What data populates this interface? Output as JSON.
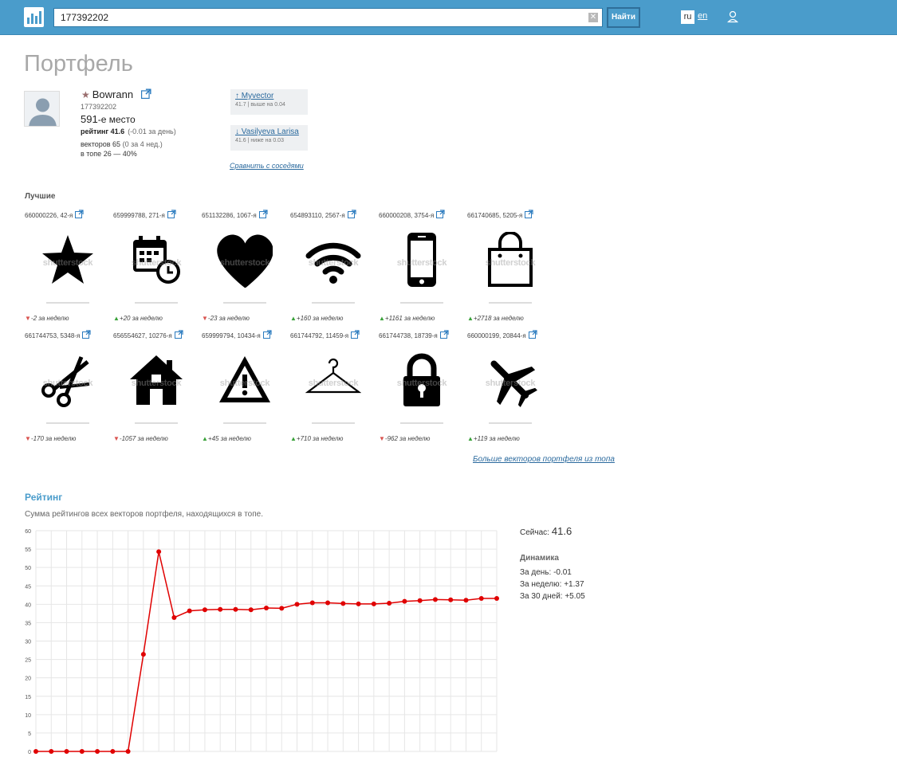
{
  "header": {
    "search_value": "177392202",
    "find_label": "Найти",
    "lang_ru": "ru",
    "lang_en": "en"
  },
  "page_title": "Портфель",
  "profile": {
    "name": "Bowrann",
    "id": "177392202",
    "place_number": "591",
    "place_suffix": "-е место",
    "rating_label": "рейтинг 41.6",
    "rating_delta": "(-0.01 за день)",
    "vectors_label": "векторов 65",
    "vectors_sub": "(0 за 4 нед.)",
    "top_label": "в топе 26 — 40%"
  },
  "neighbors": [
    {
      "name": "↑ Myvector",
      "sub": "41.7 | выше на 0.04"
    },
    {
      "name": "↓ Vasilyeva Larisa",
      "sub": "41.6 | ниже на 0.03"
    }
  ],
  "compare_link": "Сравнить с соседями",
  "best_label": "Лучшие",
  "watermark": "shutterstock",
  "tiles": [
    {
      "caption": "660000226, 42-я",
      "change": "-2 за неделю",
      "dir": "down",
      "icon": "star-icon"
    },
    {
      "caption": "659999788, 271-я",
      "change": "+20 за неделю",
      "dir": "up",
      "icon": "calendar-clock-icon"
    },
    {
      "caption": "651132286, 1067-я",
      "change": "-23 за неделю",
      "dir": "down",
      "icon": "heart-icon"
    },
    {
      "caption": "654893110, 2567-я",
      "change": "+160 за неделю",
      "dir": "up",
      "icon": "wifi-icon"
    },
    {
      "caption": "660000208, 3754-я",
      "change": "+1161 за неделю",
      "dir": "up",
      "icon": "smartphone-icon"
    },
    {
      "caption": "661740685, 5205-я",
      "change": "+2718 за неделю",
      "dir": "up",
      "icon": "shopping-bag-icon"
    },
    {
      "caption": "661744753, 5348-я",
      "change": "-170 за неделю",
      "dir": "down",
      "icon": "scissors-icon"
    },
    {
      "caption": "656554627, 10276-я",
      "change": "-1057 за неделю",
      "dir": "down",
      "icon": "house-icon"
    },
    {
      "caption": "659999794, 10434-я",
      "change": "+45 за неделю",
      "dir": "up",
      "icon": "warning-icon"
    },
    {
      "caption": "661744792, 11459-я",
      "change": "+710 за неделю",
      "dir": "up",
      "icon": "hanger-icon"
    },
    {
      "caption": "661744738, 18739-я",
      "change": "-962 за неделю",
      "dir": "down",
      "icon": "lock-icon"
    },
    {
      "caption": "660000199, 20844-я",
      "change": "+119 за неделю",
      "dir": "up",
      "icon": "airplane-icon"
    }
  ],
  "more_link": "Больше векторов портфеля из топа",
  "rating": {
    "title": "Рейтинг",
    "description": "Сумма рейтингов всех векторов портфеля, находящихся в топе.",
    "now_label": "Сейчас:",
    "now_value": "41.6",
    "dynamics_title": "Динамика",
    "day": "За день: -0.01",
    "week": "За неделю: +1.37",
    "month": "За 30 дней: +5.05"
  },
  "colors": {
    "header": "#4a9ccb",
    "line": "#e00000",
    "up": "#3aa23a",
    "down": "#d9534f"
  },
  "chart_data": {
    "type": "line",
    "y_ticks": [
      "0",
      "5",
      "10",
      "15",
      "20",
      "25",
      "30",
      "35",
      "40",
      "45",
      "50",
      "55",
      "60"
    ],
    "ylim": [
      0,
      60
    ],
    "grid": true,
    "series": [
      {
        "values": [
          0,
          0,
          0,
          0,
          0,
          0,
          0,
          26.4,
          54.3,
          36.4,
          38.2,
          38.5,
          38.6,
          38.6,
          38.5,
          39.0,
          38.9,
          40.0,
          40.4,
          40.4,
          40.2,
          40.1,
          40.1,
          40.3,
          40.8,
          41.0,
          41.3,
          41.2,
          41.1,
          41.6,
          41.6
        ]
      }
    ]
  }
}
